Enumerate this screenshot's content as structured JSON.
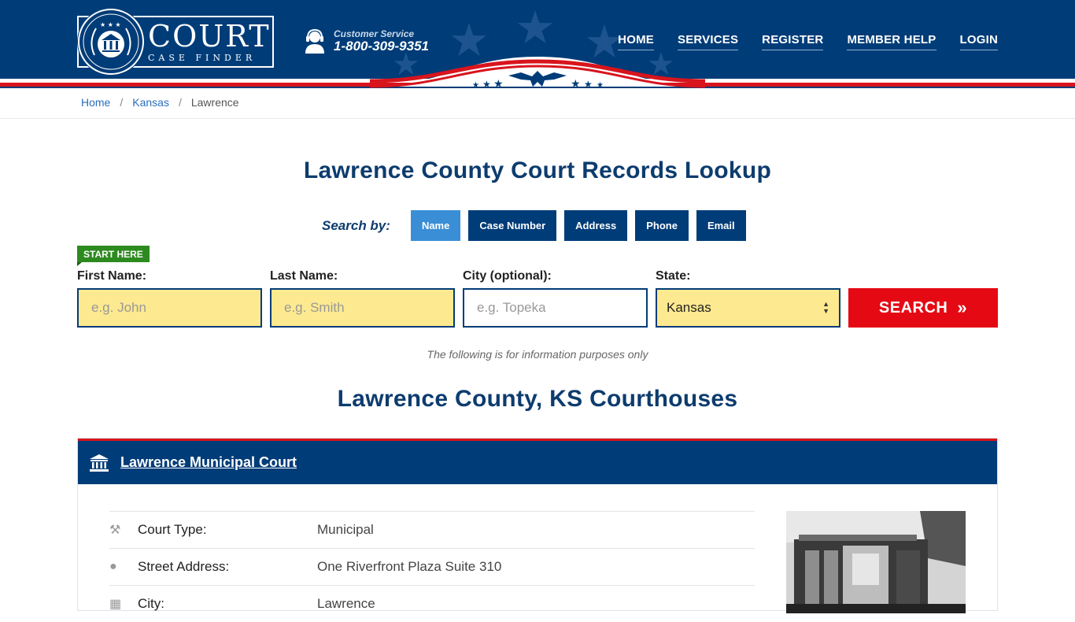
{
  "header": {
    "logo_court": "COURT",
    "logo_finder": "CASE FINDER",
    "cs_label": "Customer Service",
    "cs_phone": "1-800-309-9351",
    "nav": [
      "HOME",
      "SERVICES",
      "REGISTER",
      "MEMBER HELP",
      "LOGIN"
    ],
    "colors": {
      "navy": "#003c78",
      "red": "#d8141d"
    }
  },
  "breadcrumb": {
    "items": [
      "Home",
      "Kansas",
      "Lawrence"
    ],
    "separator": "/"
  },
  "page": {
    "title": "Lawrence County Court Records Lookup",
    "search_by_label": "Search by:",
    "tabs": [
      "Name",
      "Case Number",
      "Address",
      "Phone",
      "Email"
    ],
    "active_tab": "Name",
    "start_here": "START HERE",
    "fields": {
      "first_name": {
        "label": "First Name:",
        "placeholder": "e.g. John"
      },
      "last_name": {
        "label": "Last Name:",
        "placeholder": "e.g. Smith"
      },
      "city": {
        "label": "City (optional):",
        "placeholder": "e.g.  Topeka"
      },
      "state": {
        "label": "State:",
        "value": "Kansas"
      }
    },
    "search_button": "SEARCH",
    "info_note": "The following is for information purposes only",
    "courthouses_title": "Lawrence County, KS Courthouses"
  },
  "court": {
    "name": "Lawrence Municipal Court",
    "rows": [
      {
        "icon": "gavel-icon",
        "key": "Court Type:",
        "value": "Municipal"
      },
      {
        "icon": "map-pin-icon",
        "key": "Street Address:",
        "value": "One Riverfront Plaza Suite 310"
      },
      {
        "icon": "city-icon",
        "key": "City:",
        "value": "Lawrence"
      }
    ]
  }
}
